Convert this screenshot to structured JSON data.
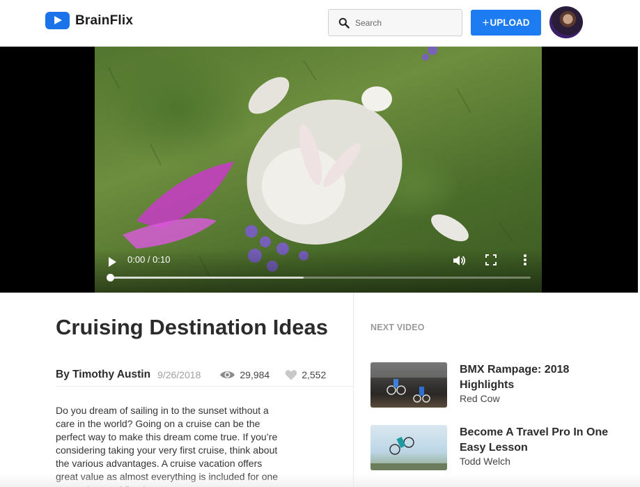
{
  "header": {
    "app_name": "BrainFlix",
    "logo_icon": "play-icon",
    "search_placeholder": "Search",
    "search_icon": "search-icon",
    "upload_label": "UPLOAD",
    "upload_plus": "+",
    "brand_color": "#1E7CF2"
  },
  "video": {
    "time_display": "0:00 / 0:10",
    "progress_fraction": 0,
    "buffered_fraction": 0.46
  },
  "article": {
    "title": "Cruising Destination Ideas",
    "author": "By Timothy Austin",
    "date": "9/26/2018",
    "views": "29,984",
    "likes": "2,552",
    "body": "Do you dream of sailing in to the sunset without a care in the world? Going on a cruise can be the perfect way to make this dream come true. If you’re considering taking your very first cruise, think about the various advantages. A cruise vacation offers great value as almost everything is included for one convenient and fixed"
  },
  "sidebar": {
    "heading": "NEXT VIDEO",
    "items": [
      {
        "title": "BMX Rampage: 2018 Highlights",
        "channel": "Red Cow"
      },
      {
        "title": "Become A Travel Pro In One Easy Lesson",
        "channel": "Todd Welch"
      }
    ]
  }
}
